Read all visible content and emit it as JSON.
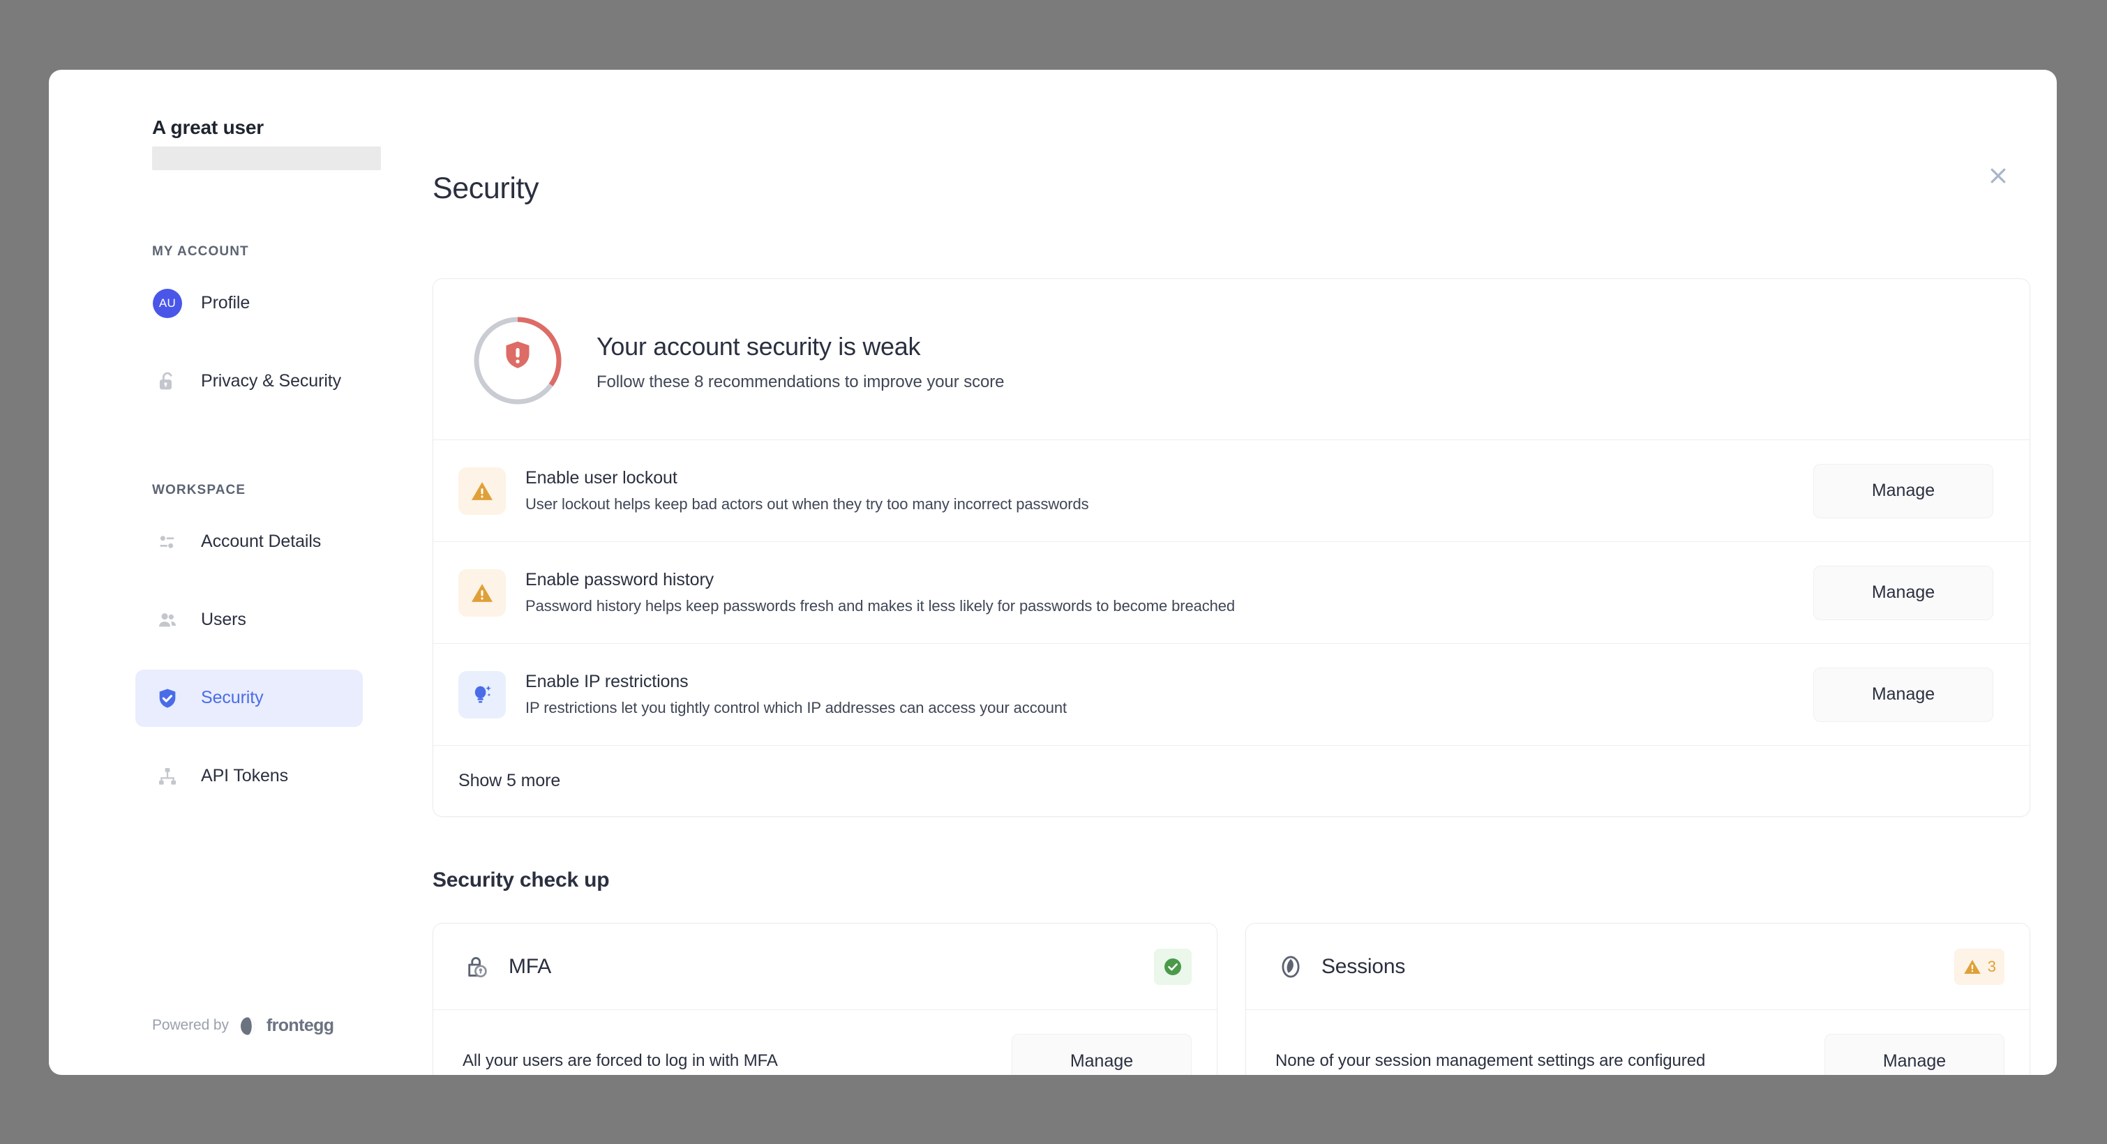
{
  "modal": {
    "close_icon": "close-icon"
  },
  "sidebar": {
    "user_name": "A great user",
    "sections": [
      {
        "label": "MY ACCOUNT"
      },
      {
        "label": "WORKSPACE"
      }
    ],
    "my_account_items": [
      {
        "label": "Profile",
        "icon": "avatar",
        "initials": "AU",
        "active": false
      },
      {
        "label": "Privacy & Security",
        "icon": "unlock-icon",
        "active": false
      }
    ],
    "workspace_items": [
      {
        "label": "Account Details",
        "icon": "sliders-icon",
        "active": false
      },
      {
        "label": "Users",
        "icon": "users-icon",
        "active": false
      },
      {
        "label": "Security",
        "icon": "shield-check-icon",
        "active": true
      },
      {
        "label": "API Tokens",
        "icon": "sitemap-icon",
        "active": false
      }
    ],
    "footer": {
      "powered_by": "Powered by",
      "brand": "frontegg",
      "brand_icon": "egg-icon"
    }
  },
  "main": {
    "page_title": "Security",
    "hero": {
      "icon": "shield-alert-icon",
      "title": "Your account security is weak",
      "subtitle": "Follow these 8 recommendations to improve your score",
      "score_percent": 35,
      "ring_color": "#dd6b66",
      "ring_track_color": "#c9ccd2"
    },
    "recommendations": [
      {
        "icon": "warning-triangle-icon",
        "icon_style": "warn",
        "title": "Enable user lockout",
        "description": "User lockout helps keep bad actors out when they try too many incorrect passwords",
        "action": "Manage"
      },
      {
        "icon": "warning-triangle-icon",
        "icon_style": "warn",
        "title": "Enable password history",
        "description": "Password history helps keep passwords fresh and makes it less likely for passwords to become breached",
        "action": "Manage"
      },
      {
        "icon": "lightbulb-icon",
        "icon_style": "tip",
        "title": "Enable IP restrictions",
        "description": "IP restrictions let you tightly control which IP addresses can access your account",
        "action": "Manage"
      }
    ],
    "show_more": "Show 5 more",
    "checkup_heading": "Security check up",
    "checkup_cards": [
      {
        "icon": "lock-mobile-icon",
        "title": "MFA",
        "status": "ok",
        "status_icon": "check-circle-icon",
        "count": "",
        "description": "All your users are forced to log in with MFA",
        "action": "Manage"
      },
      {
        "icon": "clock-icon",
        "title": "Sessions",
        "status": "warn",
        "status_icon": "warning-triangle-icon",
        "count": "3",
        "description": "None of your session management settings are configured",
        "action": "Manage"
      }
    ]
  },
  "colors": {
    "accent": "#4a6ce8",
    "accent_bg": "#e9edfd",
    "danger": "#dd6b66",
    "warning": "#e0a038",
    "warning_bg": "#fdf3e6",
    "success": "#4a9a4a",
    "success_bg": "#eaf7ea",
    "backdrop": "#7b7b7b"
  }
}
